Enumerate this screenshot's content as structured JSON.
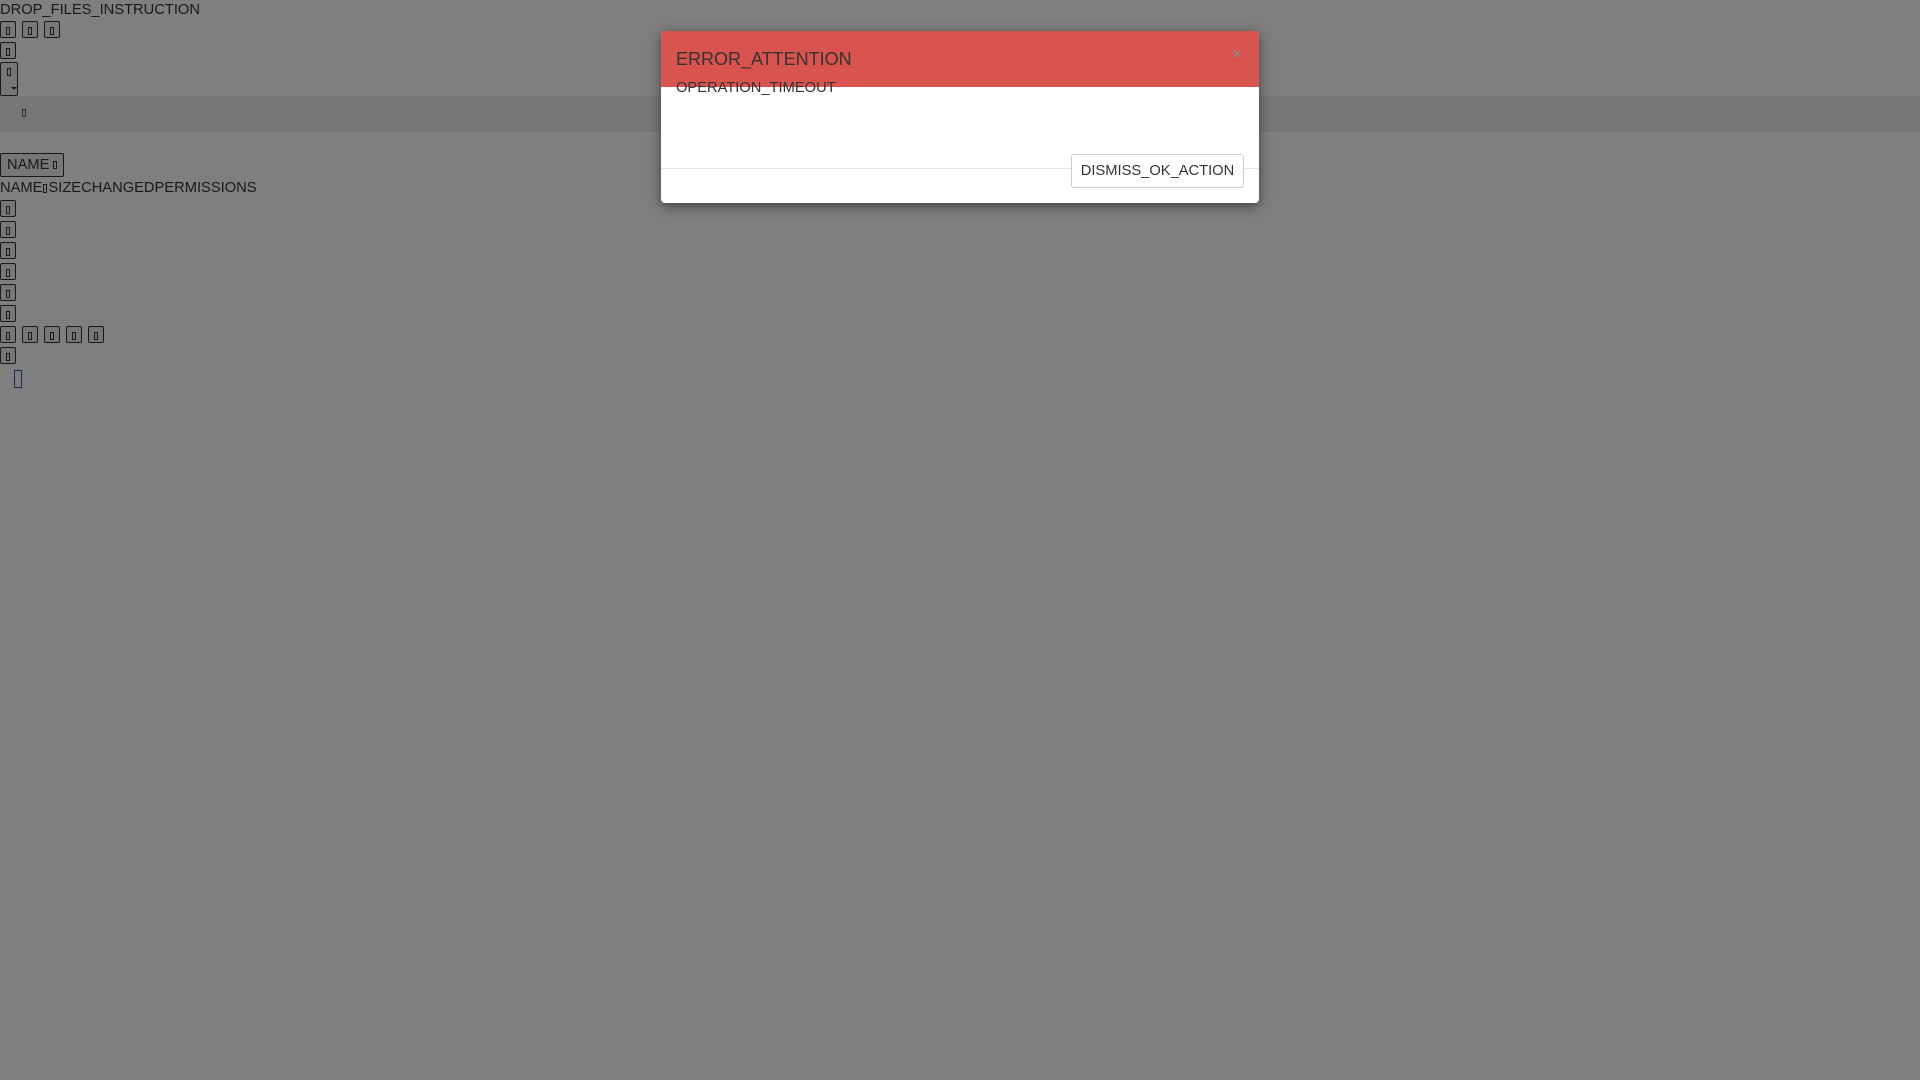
{
  "background": {
    "drop_instruction": "DROP_FILES_INSTRUCTION",
    "sort_button_label": "NAME",
    "columns": {
      "name": "NAME",
      "size": "SIZE",
      "changed": "CHANGED",
      "permissions": "PERMISSIONS"
    },
    "icons": {
      "toolbar": [
        "glyph-icon",
        "glyph-icon",
        "glyph-icon"
      ],
      "breadcrumb_home": "home-icon",
      "file_actions": [
        "glyph-icon",
        "glyph-icon",
        "glyph-icon",
        "glyph-icon",
        "glyph-icon"
      ]
    }
  },
  "modal": {
    "title": "ERROR_ATTENTION",
    "close_symbol": "×",
    "message": "OPERATION_TIMEOUT",
    "ok_label": "DISMISS_OK_ACTION",
    "header_color": "#d9534f"
  },
  "colors": {
    "backdrop": "rgba(0,0,0,0.5)",
    "breadcrumb_bar": "#ececec",
    "upload_indicator": "#2a5a9a"
  }
}
